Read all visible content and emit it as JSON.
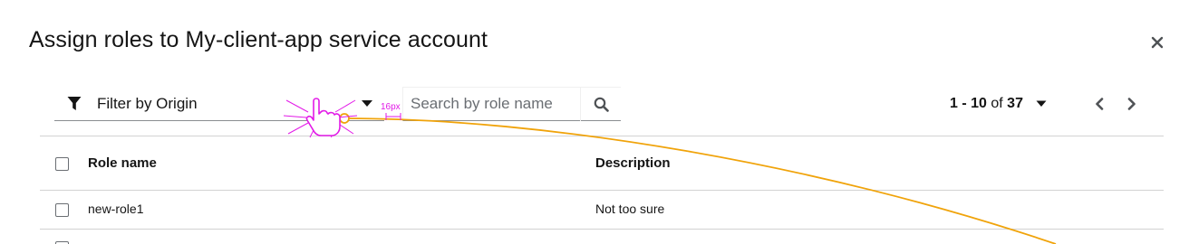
{
  "modal": {
    "title": "Assign roles to My-client-app service account",
    "close_icon": "close-icon"
  },
  "toolbar": {
    "filter_label": "Filter by Origin",
    "filter_icon": "filter-icon",
    "search_placeholder": "Search by role name",
    "search_value": "",
    "pagination": {
      "range": "1 - 10",
      "of_text": "of",
      "total": "37"
    }
  },
  "table": {
    "columns": [
      "Role name",
      "Description"
    ],
    "rows": [
      {
        "name": "new-role1",
        "description": "Not too sure"
      }
    ]
  },
  "annotation": {
    "spacing_label": "16px",
    "colors": {
      "cursor_highlight": "#e21ae7",
      "drag_path": "#f0a30a"
    }
  }
}
